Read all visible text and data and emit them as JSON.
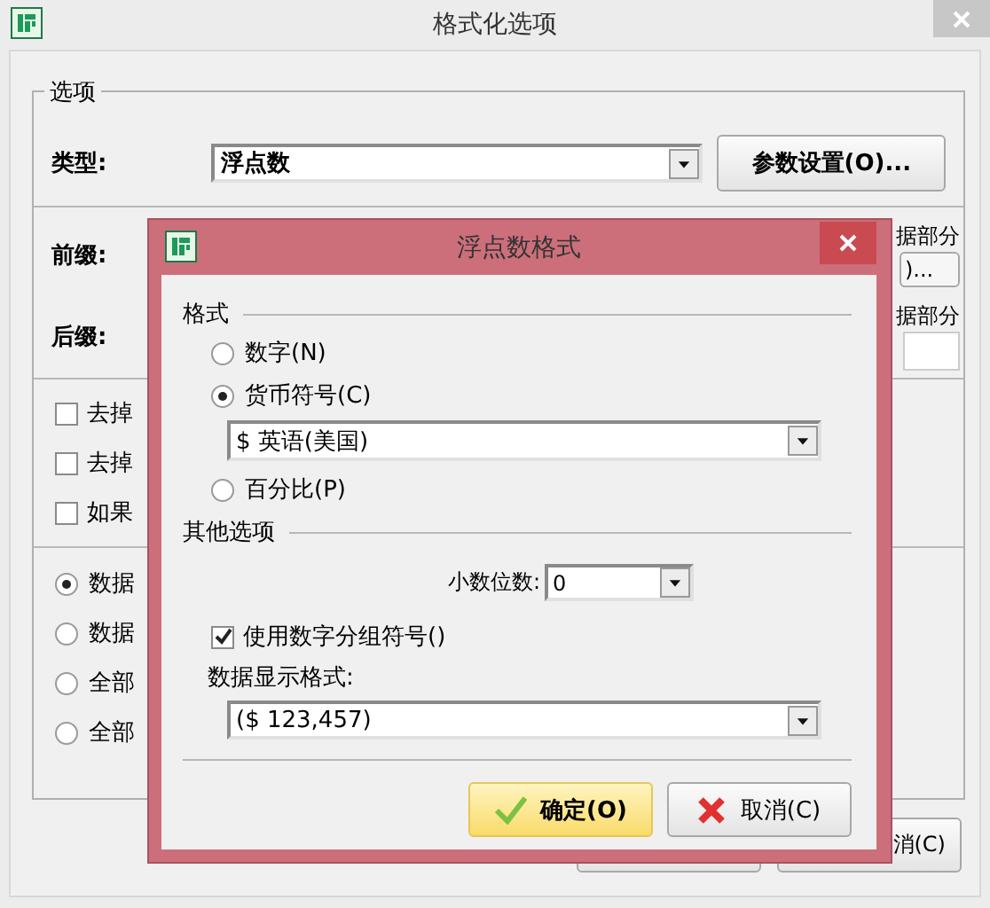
{
  "window": {
    "title": "格式化选项"
  },
  "options_group": {
    "title": "选项",
    "type_label": "类型:",
    "type_value": "浮点数",
    "settings_button": "参数设置(O)...",
    "prefix_label": "前缀:",
    "suffix_label": "后缀:",
    "right_text_1": "据部分",
    "right_button": ")...",
    "right_text_2": "据部分",
    "checkboxes": [
      {
        "label": "去掉",
        "checked": false
      },
      {
        "label": "去掉",
        "checked": false
      },
      {
        "label": "如果",
        "checked": false
      }
    ],
    "radios": [
      {
        "label": "数据",
        "selected": true
      },
      {
        "label": "数据",
        "selected": false
      },
      {
        "label": "全部",
        "selected": false
      },
      {
        "label": "全部",
        "selected": false
      }
    ]
  },
  "bottom_cancel": "消(C)",
  "dialog": {
    "title": "浮点数格式",
    "format_title": "格式",
    "format_options": [
      {
        "label": "数字(N)",
        "selected": false
      },
      {
        "label": "货币符号(C)",
        "selected": true
      },
      {
        "label": "百分比(P)",
        "selected": false
      }
    ],
    "currency_value": "$ 英语(美国)",
    "other_title": "其他选项",
    "decimals_label": "小数位数:",
    "decimals_value": "0",
    "grouping": {
      "label": "使用数字分组符号()",
      "checked": true
    },
    "display_label": "数据显示格式:",
    "display_value": "($ 123,457)",
    "ok_button": "确定(O)",
    "cancel_button": "取消(C)"
  }
}
